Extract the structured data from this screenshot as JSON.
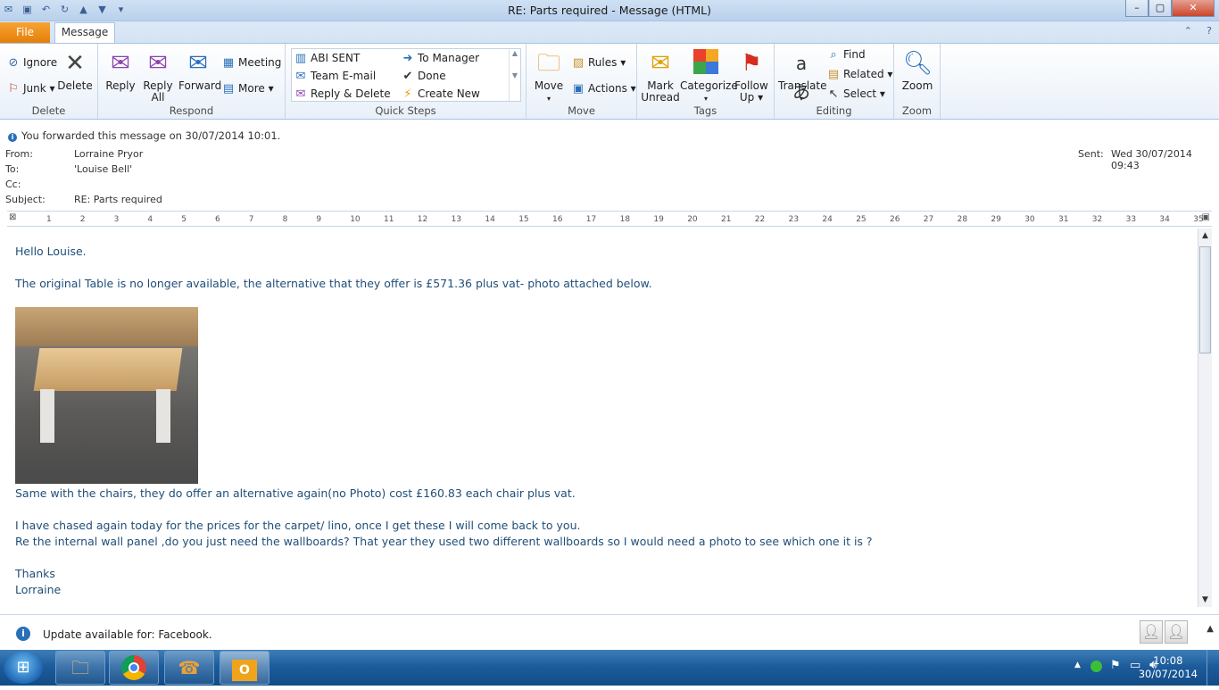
{
  "window": {
    "title": "RE: Parts required  -  Message (HTML)",
    "minimize": "–",
    "maximize": "▢",
    "close": "✕"
  },
  "tabs": {
    "file": "File",
    "message": "Message"
  },
  "ribbon": {
    "delete_group": {
      "label": "Delete",
      "ignore": "Ignore",
      "junk": "Junk ▾",
      "delete": "Delete"
    },
    "respond_group": {
      "label": "Respond",
      "reply": "Reply",
      "reply_all_1": "Reply",
      "reply_all_2": "All",
      "forward": "Forward",
      "meeting": "Meeting",
      "more": "More ▾"
    },
    "quick_steps": {
      "label": "Quick Steps",
      "items": [
        "ABI SENT",
        "To Manager",
        "Team E-mail",
        "Done",
        "Reply & Delete",
        "Create New"
      ]
    },
    "move_group": {
      "label": "Move",
      "move": "Move",
      "rules": "Rules ▾",
      "actions": "Actions ▾"
    },
    "tags_group": {
      "label": "Tags",
      "mark_unread_1": "Mark",
      "mark_unread_2": "Unread",
      "categorize": "Categorize",
      "follow_up_1": "Follow",
      "follow_up_2": "Up ▾"
    },
    "editing_group": {
      "label": "Editing",
      "translate": "Translate",
      "find": "Find",
      "related": "Related ▾",
      "select": "Select ▾"
    },
    "zoom_group": {
      "label": "Zoom",
      "zoom": "Zoom"
    }
  },
  "message": {
    "info_bar": "You forwarded this message on 30/07/2014 10:01.",
    "from_label": "From:",
    "from": "Lorraine Pryor",
    "to_label": "To:",
    "to": "'Louise Bell'",
    "cc_label": "Cc:",
    "cc": "",
    "subject_label": "Subject:",
    "subject": "RE: Parts required",
    "sent_label": "Sent:",
    "sent": "Wed 30/07/2014 09:43"
  },
  "ruler_ticks": [
    "1",
    "2",
    "3",
    "4",
    "5",
    "6",
    "7",
    "8",
    "9",
    "10",
    "11",
    "12",
    "13",
    "14",
    "15",
    "16",
    "17",
    "18",
    "19",
    "20",
    "21",
    "22",
    "23",
    "24",
    "25",
    "26",
    "27",
    "28",
    "29",
    "30",
    "31",
    "32",
    "33",
    "34",
    "35"
  ],
  "body": {
    "greeting": "Hello Louise.",
    "line1": "The original Table is no longer available, the alternative that they offer is £571.36 plus vat- photo attached below.",
    "line2": "Same with the chairs, they do offer an alternative again(no Photo) cost £160.83 each chair  plus vat.",
    "line3": "I have chased again today for the prices for the carpet/ lino, once I get these I will come back to you.",
    "line4": "Re the internal wall panel ,do you just need the wallboards?   That year they used two different wallboards so I would need a photo to see which one it is ?",
    "thanks": "Thanks",
    "signature": "Lorraine"
  },
  "update_bar": {
    "text": "Update available for: Facebook."
  },
  "taskbar": {
    "time": "10:08",
    "date": "30/07/2014"
  }
}
